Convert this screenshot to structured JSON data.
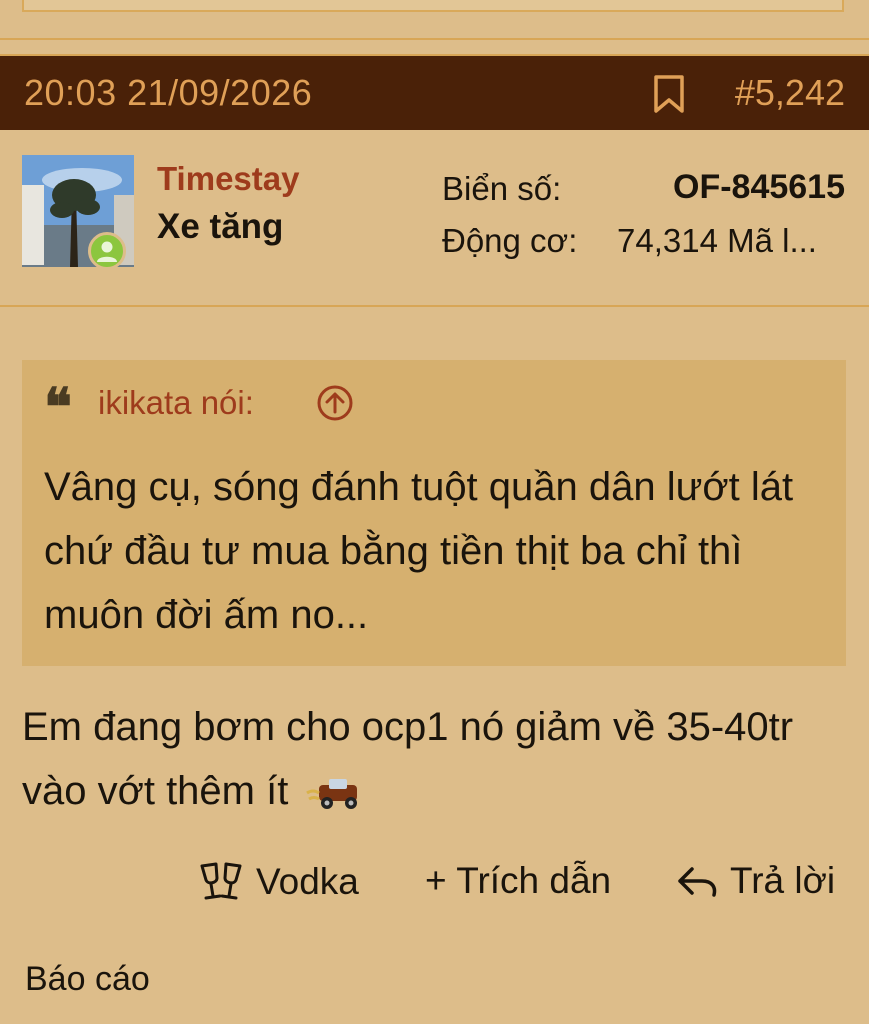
{
  "post": {
    "datetime": "20:03 21/09/2026",
    "number": "#5,242"
  },
  "user": {
    "name": "Timestay",
    "title": "Xe tăng",
    "plate_label": "Biển số:",
    "plate_value": "OF-845615",
    "engine_label": "Động cơ:",
    "engine_value": "74,314 Mã l..."
  },
  "quote": {
    "author": "ikikata nói:",
    "text": "Vâng cụ, sóng đánh tuột quần dân lướt lát chứ đầu tư mua bằng tiền thịt ba chỉ thì muôn đời ấm no..."
  },
  "body": {
    "text": "Em đang bơm cho ocp1 nó giảm về 35-40tr vào vớt thêm ít"
  },
  "actions": {
    "vodka": "Vodka",
    "quote": "+ Trích dẫn",
    "reply": "Trả lời",
    "report": "Báo cáo"
  },
  "colors": {
    "background": "#ddbd8a",
    "header_bg": "#4a2108",
    "header_text": "#e0a057",
    "quote_bg": "#d6b06f",
    "username": "#9e3b1c",
    "online": "#8cc63e"
  },
  "icons": [
    "bookmark-icon",
    "online-status-icon",
    "quote-mark-icon",
    "arrow-up-circle-icon",
    "cheers-glasses-icon",
    "reply-arrow-icon",
    "car-emoji-icon"
  ]
}
